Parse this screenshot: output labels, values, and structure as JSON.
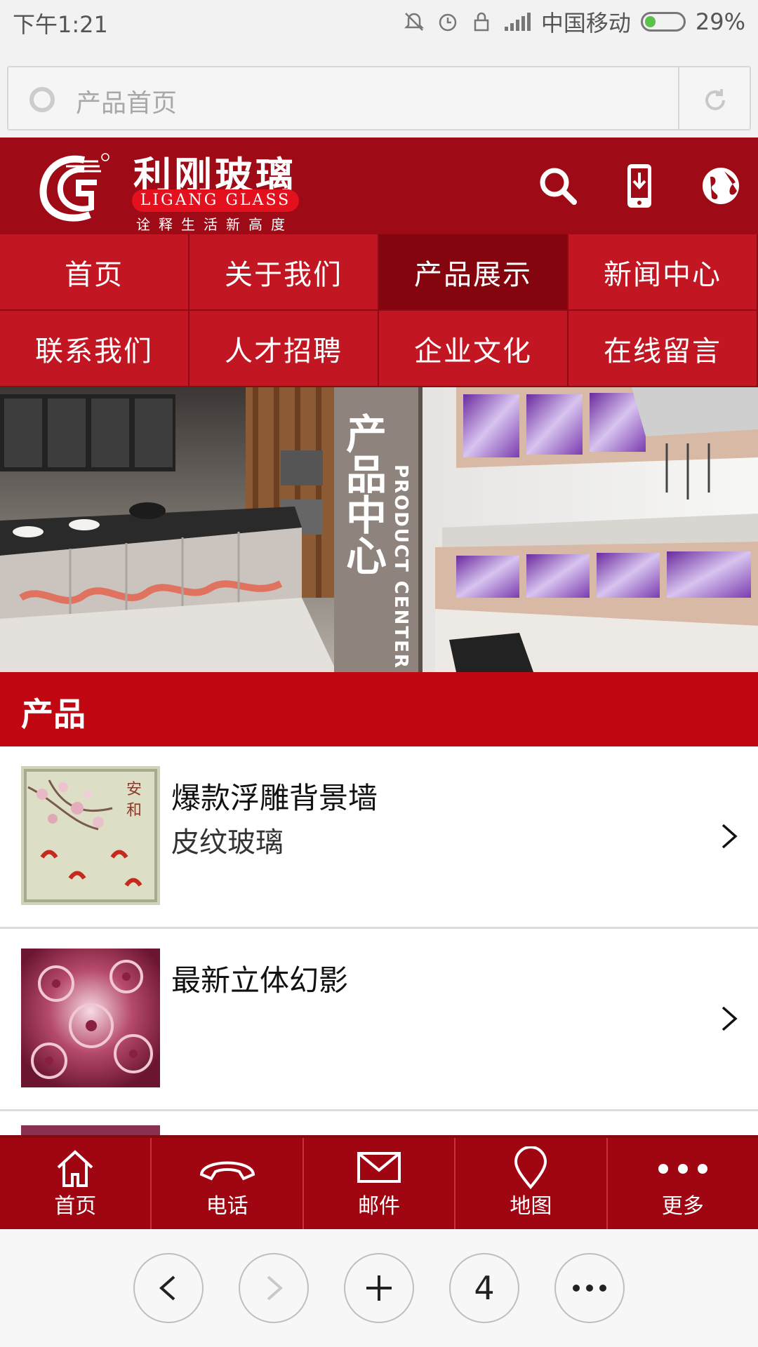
{
  "status_bar": {
    "time": "下午1:21",
    "carrier": "中国移动",
    "battery": "29%",
    "battery_level": 0.29,
    "icons": [
      "mute-icon",
      "alarm-icon",
      "lock-icon",
      "signal-icon"
    ]
  },
  "browser": {
    "page_title": "产品首页",
    "tab_count": "4"
  },
  "header": {
    "brand_cn": "利刚玻璃",
    "brand_en": "LIGANG GLASS",
    "slogan": "诠释生活新高度",
    "colors": {
      "primary": "#9e0b16",
      "nav": "#c21622",
      "active": "#85050f"
    }
  },
  "nav": {
    "items": [
      {
        "label": "首页"
      },
      {
        "label": "关于我们"
      },
      {
        "label": "产品展示",
        "active": true
      },
      {
        "label": "新闻中心"
      },
      {
        "label": "联系我们"
      },
      {
        "label": "人才招聘"
      },
      {
        "label": "企业文化"
      },
      {
        "label": "在线留言"
      }
    ]
  },
  "banner": {
    "title_cn": "产品中心",
    "title_en": "PRODUCT CENTER"
  },
  "section": {
    "title": "产品"
  },
  "products": [
    {
      "title": "爆款浮雕背景墙",
      "subtitle": "皮纹玻璃"
    },
    {
      "title": "最新立体幻影",
      "subtitle": ""
    }
  ],
  "toolbar": {
    "items": [
      {
        "label": "首页",
        "icon": "home-icon"
      },
      {
        "label": "电话",
        "icon": "phone-icon"
      },
      {
        "label": "邮件",
        "icon": "mail-icon"
      },
      {
        "label": "地图",
        "icon": "map-pin-icon"
      },
      {
        "label": "更多",
        "icon": "more-icon"
      }
    ]
  }
}
